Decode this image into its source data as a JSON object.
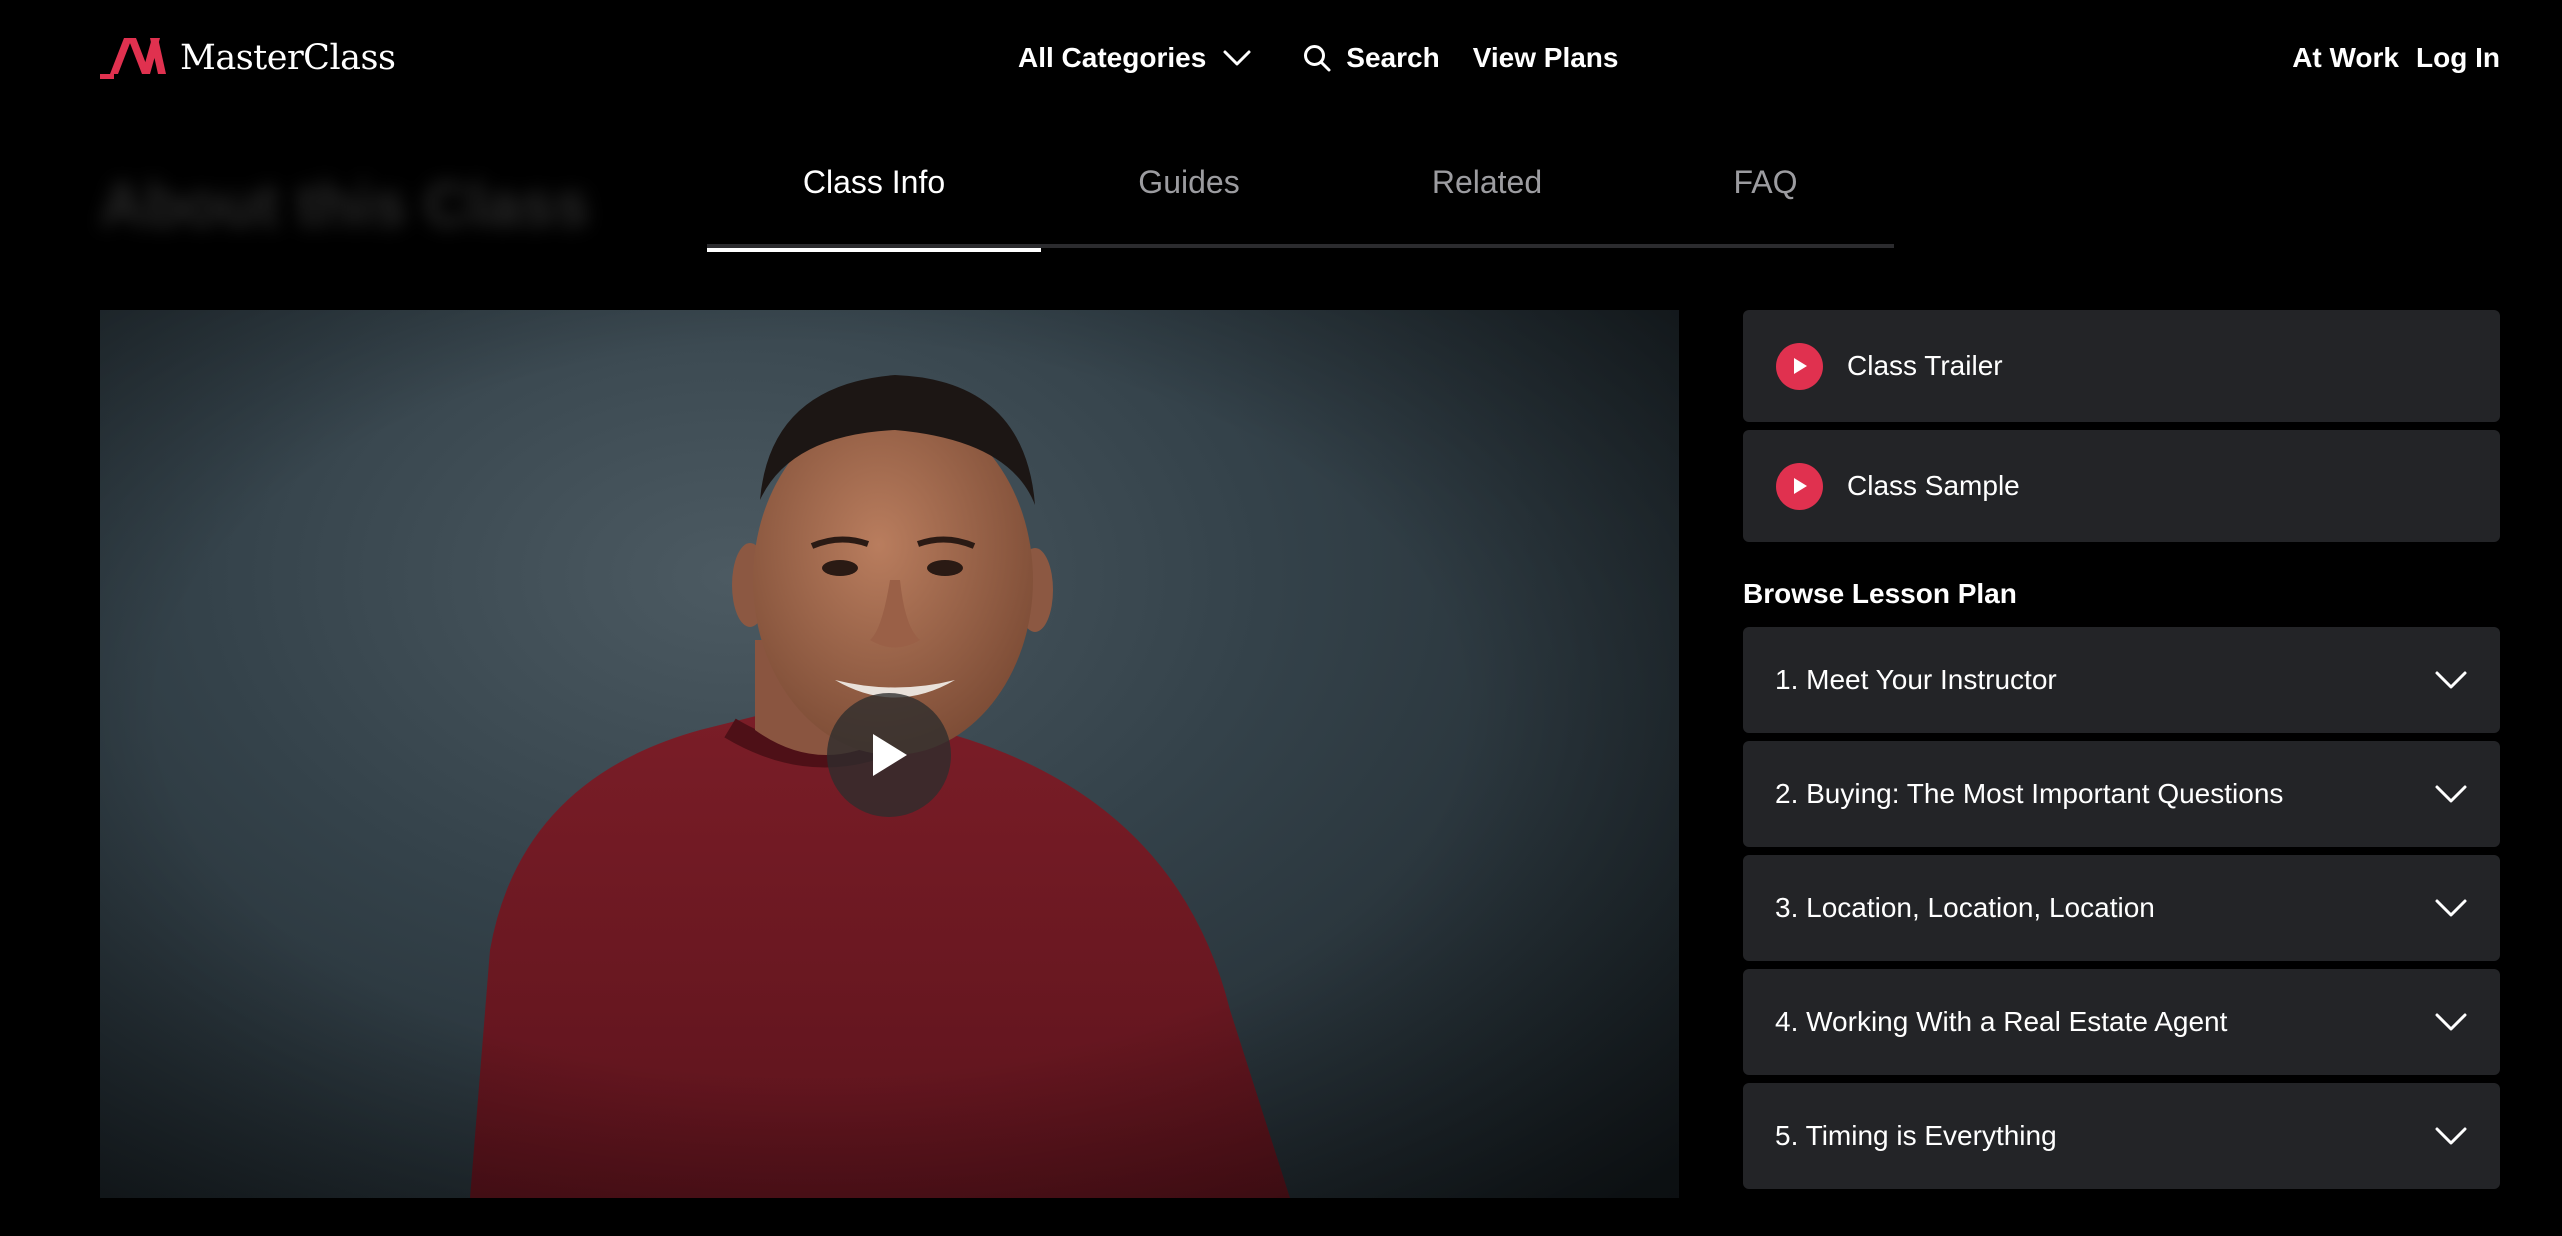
{
  "brand": {
    "name": "MasterClass",
    "accent_color": "#e0314f"
  },
  "nav": {
    "categories_label": "All Categories",
    "search_label": "Search",
    "plans_label": "View Plans",
    "at_work_label": "At Work",
    "login_label": "Log In"
  },
  "section_title": "About this Class",
  "tabs": [
    {
      "label": "Class Info",
      "active": true
    },
    {
      "label": "Guides",
      "active": false
    },
    {
      "label": "Related",
      "active": false
    },
    {
      "label": "FAQ",
      "active": false
    }
  ],
  "video": {
    "play_icon": "play-icon"
  },
  "media": [
    {
      "label": "Class Trailer",
      "icon": "play-icon"
    },
    {
      "label": "Class Sample",
      "icon": "play-icon"
    }
  ],
  "lesson_plan": {
    "heading": "Browse Lesson Plan",
    "lessons": [
      {
        "title": "1. Meet Your Instructor",
        "icon": "chevron-down-icon"
      },
      {
        "title": "2. Buying: The Most Important Questions",
        "icon": "chevron-down-icon"
      },
      {
        "title": "3. Location, Location, Location",
        "icon": "chevron-down-icon"
      },
      {
        "title": "4. Working With a Real Estate Agent",
        "icon": "chevron-down-icon"
      },
      {
        "title": "5. Timing is Everything",
        "icon": "chevron-down-icon"
      }
    ]
  }
}
